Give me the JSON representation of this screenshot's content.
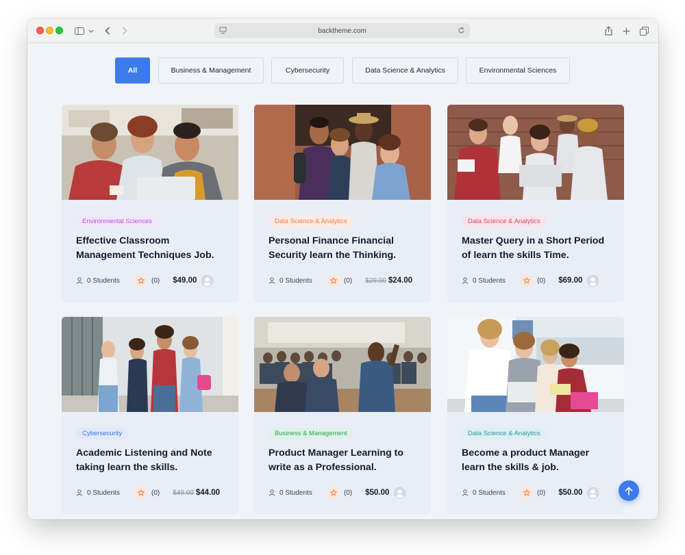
{
  "browser": {
    "url": "backtheme.com"
  },
  "filters": [
    {
      "label": "All",
      "active": true
    },
    {
      "label": "Business & Management",
      "active": false
    },
    {
      "label": "Cybersecurity",
      "active": false
    },
    {
      "label": "Data Science & Analytics",
      "active": false
    },
    {
      "label": "Environmental Sciences",
      "active": false
    }
  ],
  "courses": [
    {
      "category": "Environmental Sciences",
      "title_line1": "Effective Classroom",
      "title_line2": "Management Techniques Job.",
      "students": "0 Students",
      "rating": "(0)",
      "old_price": "",
      "price": "$49.00"
    },
    {
      "category": "Data Science & Analytics",
      "title_line1": "Personal Finance Financial",
      "title_line2": "Security learn the Thinking.",
      "students": "0 Students",
      "rating": "(0)",
      "old_price": "$29.00",
      "price": "$24.00"
    },
    {
      "category": "Data Science & Analytics",
      "title_line1": "Master Query in a Short Period",
      "title_line2": "of learn the skills Time.",
      "students": "0 Students",
      "rating": "(0)",
      "old_price": "",
      "price": "$69.00"
    },
    {
      "category": "Cybersecurity",
      "title_line1": "Academic Listening and Note",
      "title_line2": "taking learn the skills.",
      "students": "0 Students",
      "rating": "(0)",
      "old_price": "$49.00",
      "price": "$44.00"
    },
    {
      "category": "Business & Management",
      "title_line1": "Product Manager Learning to",
      "title_line2": "write as a Professional.",
      "students": "0 Students",
      "rating": "(0)",
      "old_price": "",
      "price": "$50.00"
    },
    {
      "category": "Data Science & Analytics",
      "title_line1": "Become a product Manager",
      "title_line2": "learn the skills & job.",
      "students": "0 Students",
      "rating": "(0)",
      "old_price": "",
      "price": "$50.00"
    }
  ],
  "colors": {
    "accent": "#3d7bea",
    "star": "#ef7d4c"
  }
}
